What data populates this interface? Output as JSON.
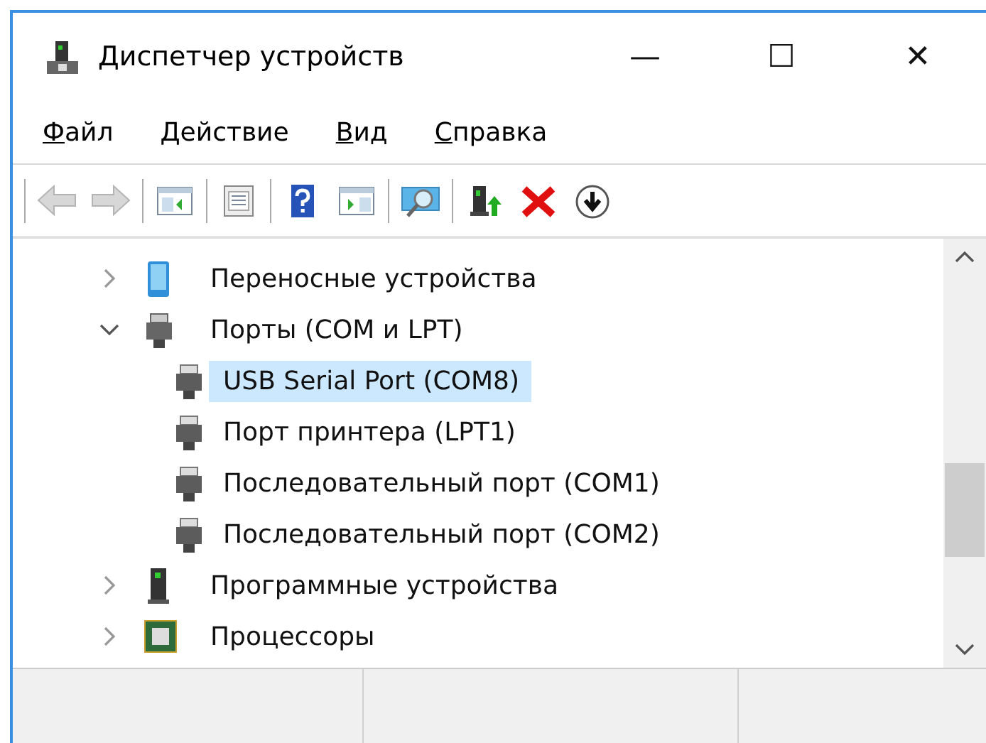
{
  "window": {
    "title": "Диспетчер устройств",
    "controls": [
      "—",
      "☐",
      "✕"
    ]
  },
  "menu": [
    {
      "label": "Файл"
    },
    {
      "label": "Действие"
    },
    {
      "label": "Вид"
    },
    {
      "label": "Справка"
    }
  ],
  "toolbar_groups": [
    [
      {
        "disabled": true
      },
      {
        "disabled": true
      }
    ],
    [
      {
        "disabled": false
      }
    ],
    [
      {
        "disabled": false
      }
    ],
    [
      {
        "disabled": false
      },
      {
        "disabled": false
      }
    ],
    [
      {
        "disabled": false
      }
    ],
    [
      {
        "disabled": false
      },
      {
        "disabled": false
      },
      {
        "disabled": false
      }
    ]
  ],
  "tree": [
    {
      "label": "Переносные устройства",
      "expanded": false
    },
    {
      "label": "Порты (COM и LPT)",
      "expanded": true,
      "children": [
        {
          "label": "USB Serial Port (COM8)",
          "selected": true
        },
        {
          "label": "Порт принтера (LPT1)",
          "selected": false
        },
        {
          "label": "Последовательный порт (COM1)",
          "selected": false
        },
        {
          "label": "Последовательный порт (COM2)",
          "selected": false
        }
      ]
    },
    {
      "label": "Программные устройства",
      "expanded": false
    },
    {
      "label": "Процессоры",
      "expanded": false
    }
  ]
}
